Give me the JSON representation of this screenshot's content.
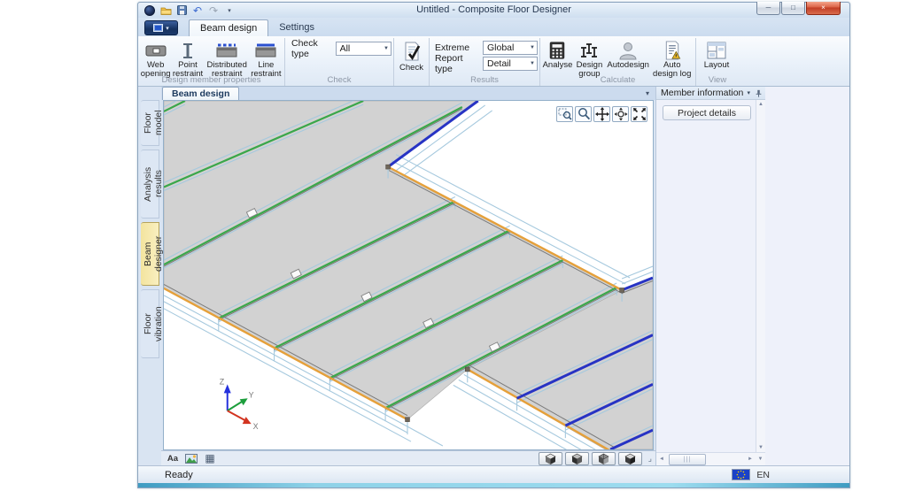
{
  "window": {
    "title": "Untitled - Composite Floor Designer",
    "minimize_glyph": "─",
    "maximize_glyph": "□",
    "close_glyph": "×"
  },
  "qat": {
    "undo_glyph": "↶",
    "redo_glyph": "↷",
    "more_glyph": "▾",
    "menu_caret": "▾"
  },
  "tabs": {
    "beam_design": "Beam design",
    "settings": "Settings"
  },
  "ribbon": {
    "group1": {
      "label": "Design member properties",
      "web_opening": "Web opening",
      "point_restraint": "Point restraint",
      "distributed_restraint": "Distributed restraint",
      "line_restraint": "Line restraint"
    },
    "group2": {
      "label": "Check",
      "check_type_label": "Check type",
      "check_type_value": "All"
    },
    "group3": {
      "check_button": "Check"
    },
    "group4": {
      "label": "Results",
      "extreme_label": "Extreme",
      "extreme_value": "Global",
      "report_type_label": "Report type",
      "report_type_value": "Detail"
    },
    "group5": {
      "label": "Calculate",
      "analyse": "Analyse",
      "design_group": "Design group",
      "autodesign": "Autodesign",
      "auto_design_log": "Auto design log"
    },
    "group6": {
      "label": "View",
      "layout": "Layout"
    }
  },
  "side_tabs": {
    "floor_model": "Floor model",
    "analysis_results": "Analysis results",
    "beam_designer": "Beam designer",
    "floor_vibration": "Floor vibration"
  },
  "doc_tab": {
    "label": "Beam design",
    "menu_glyph": "▾"
  },
  "viewport_bar": {
    "text_style": "Aa",
    "grid_glyph": "▦",
    "resize_glyph": "⌟"
  },
  "panel": {
    "title": "Member information",
    "caret_glyph": "▾",
    "project_details": "Project details",
    "scroll_up": "▲",
    "scroll_down": "▼",
    "scroll_left": "◄",
    "scroll_right": "►",
    "thumb_grip": "|||"
  },
  "statusbar": {
    "text": "Ready",
    "language": "EN"
  },
  "scene": {
    "colors": {
      "slab": "#d2d2d2",
      "green": "#3aa74a",
      "orange": "#e5a03a",
      "blue": "#2733c4",
      "wire": "#a6c9de",
      "axis_x": "#d23420",
      "axis_y": "#1d9e3c",
      "axis_z": "#2431dd"
    },
    "axis_labels": {
      "x": "X",
      "y": "Y",
      "z": "Z"
    }
  }
}
